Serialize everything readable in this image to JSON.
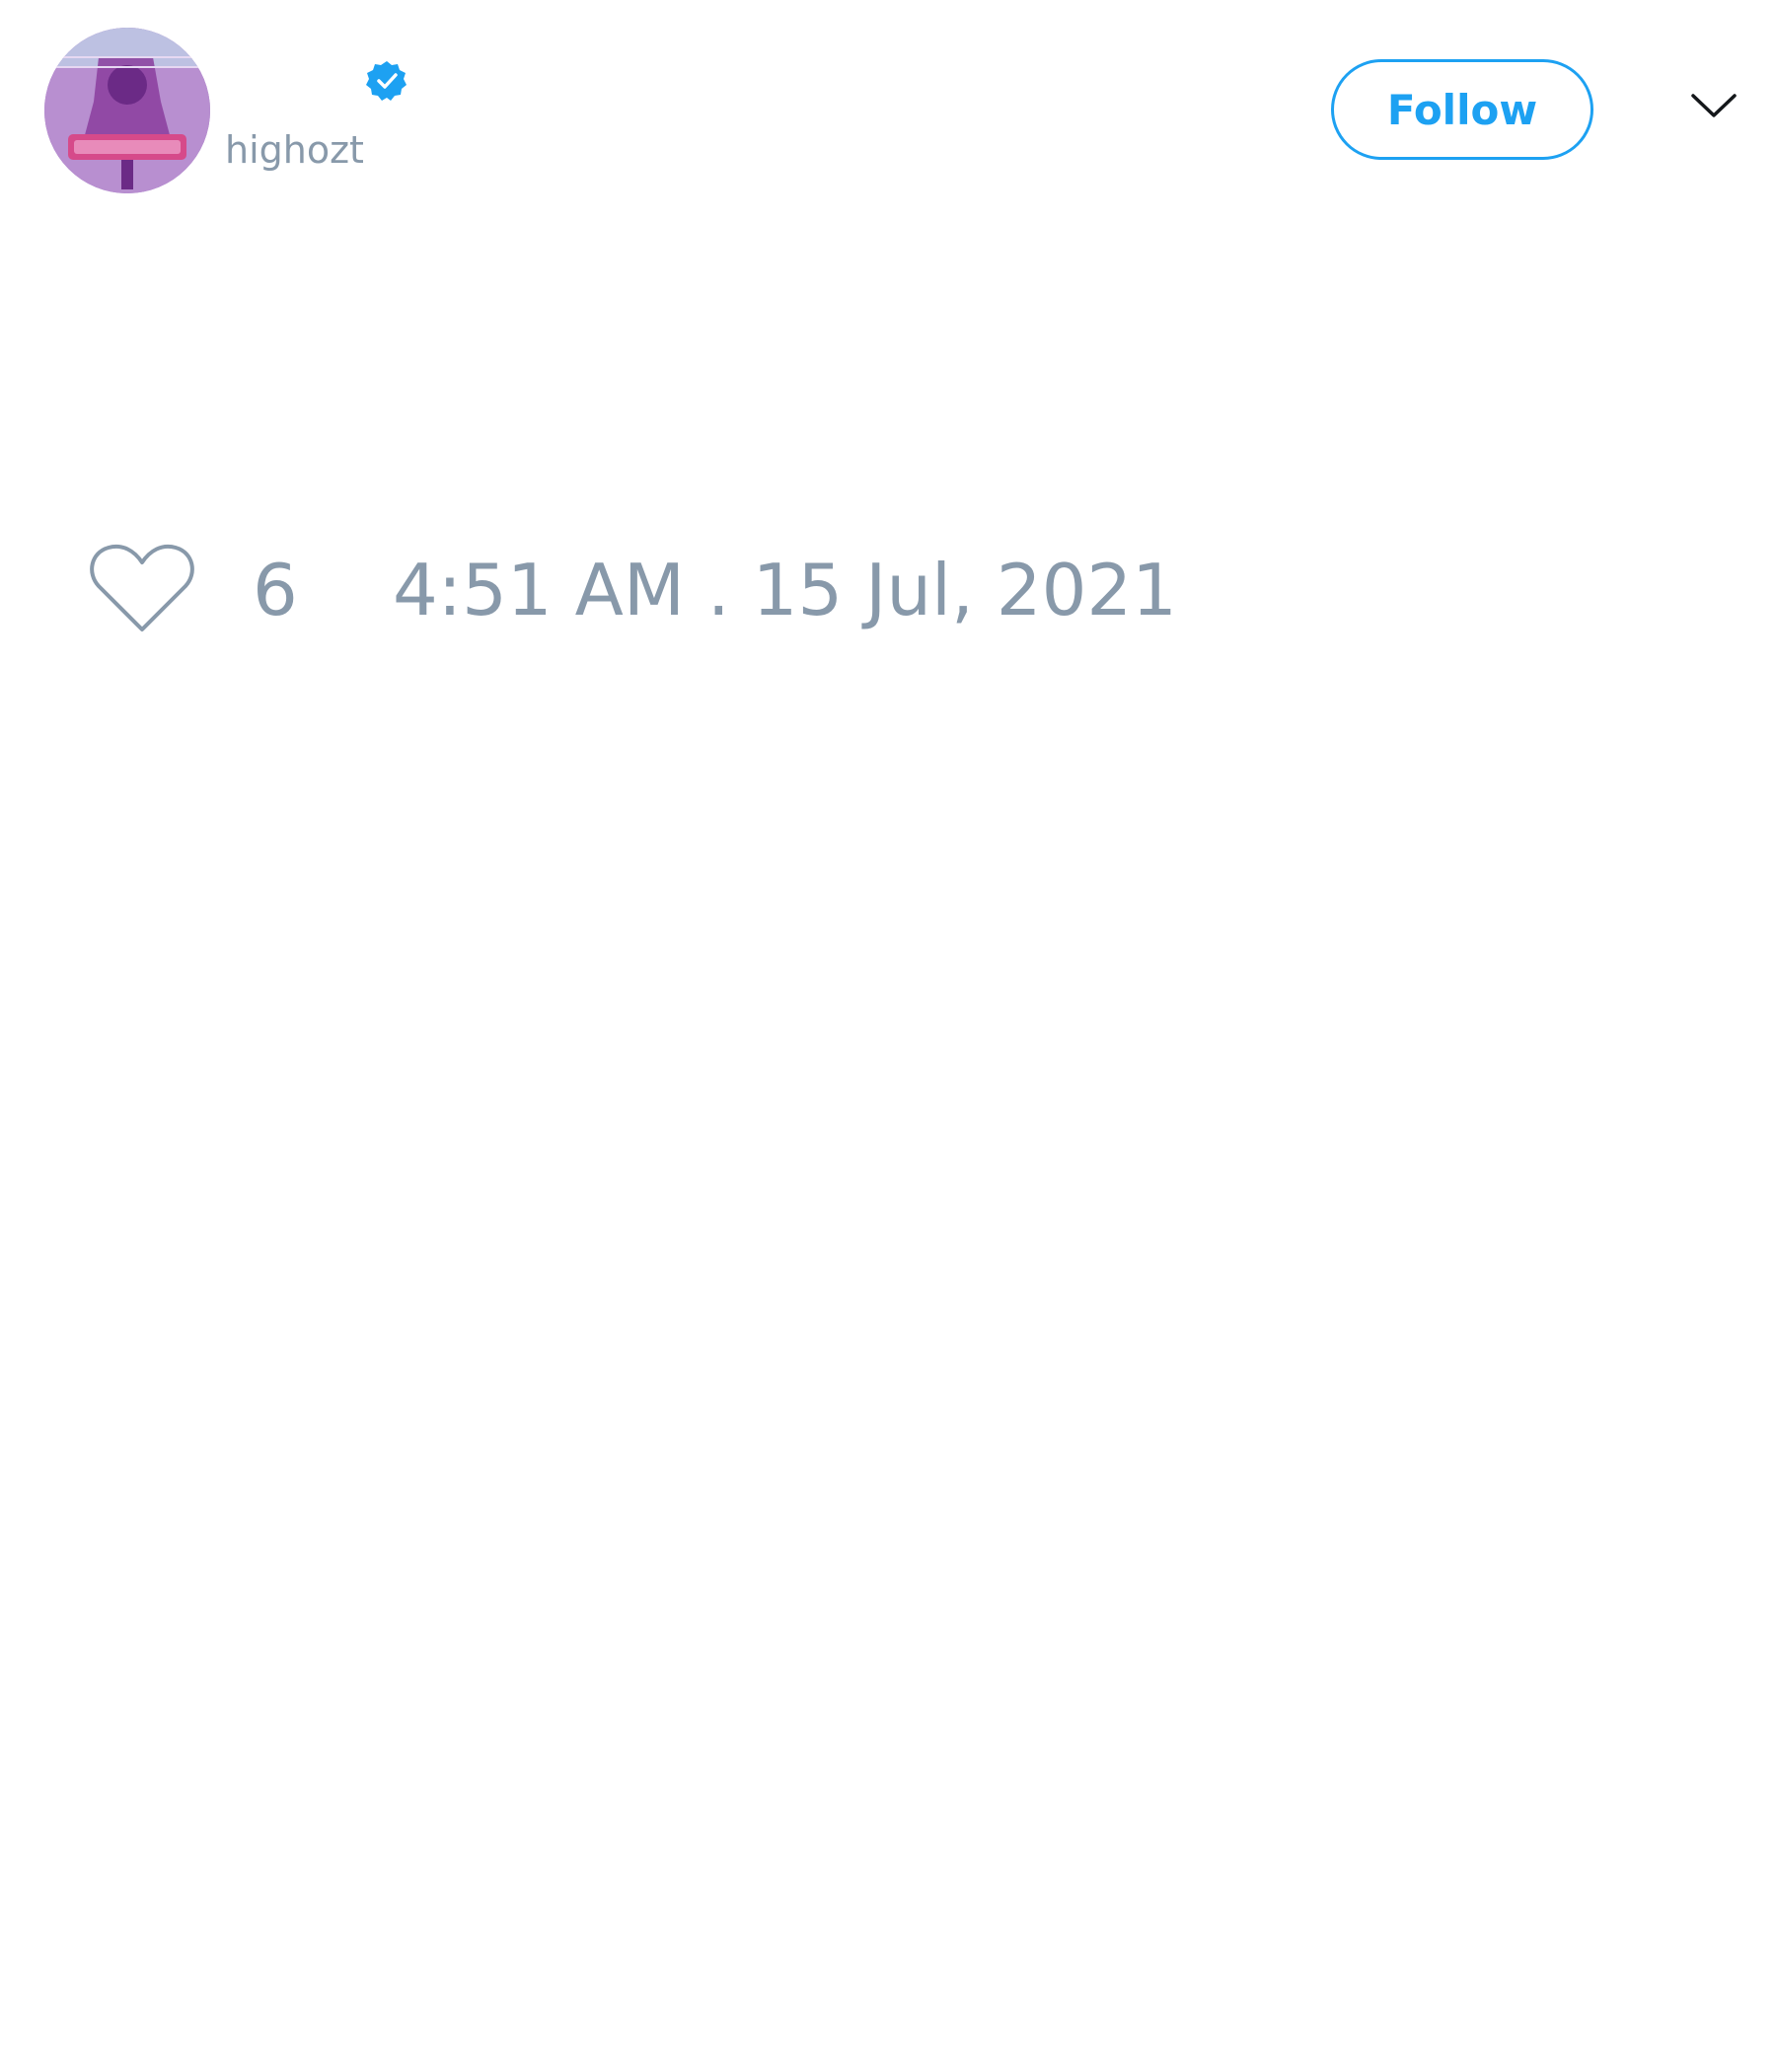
{
  "author": {
    "handle": "highozt",
    "verified": true,
    "avatar_icon": "avatar-icon"
  },
  "actions": {
    "follow_label": "Follow",
    "menu_icon": "chevron-down-icon"
  },
  "tweet": {
    "like_icon": "heart-icon",
    "likes": "6",
    "timestamp": "4:51 AM . 15 Jul, 2021"
  },
  "colors": {
    "accent": "#1da1f2",
    "muted_text": "#8899aa",
    "background": "#ffffff"
  }
}
